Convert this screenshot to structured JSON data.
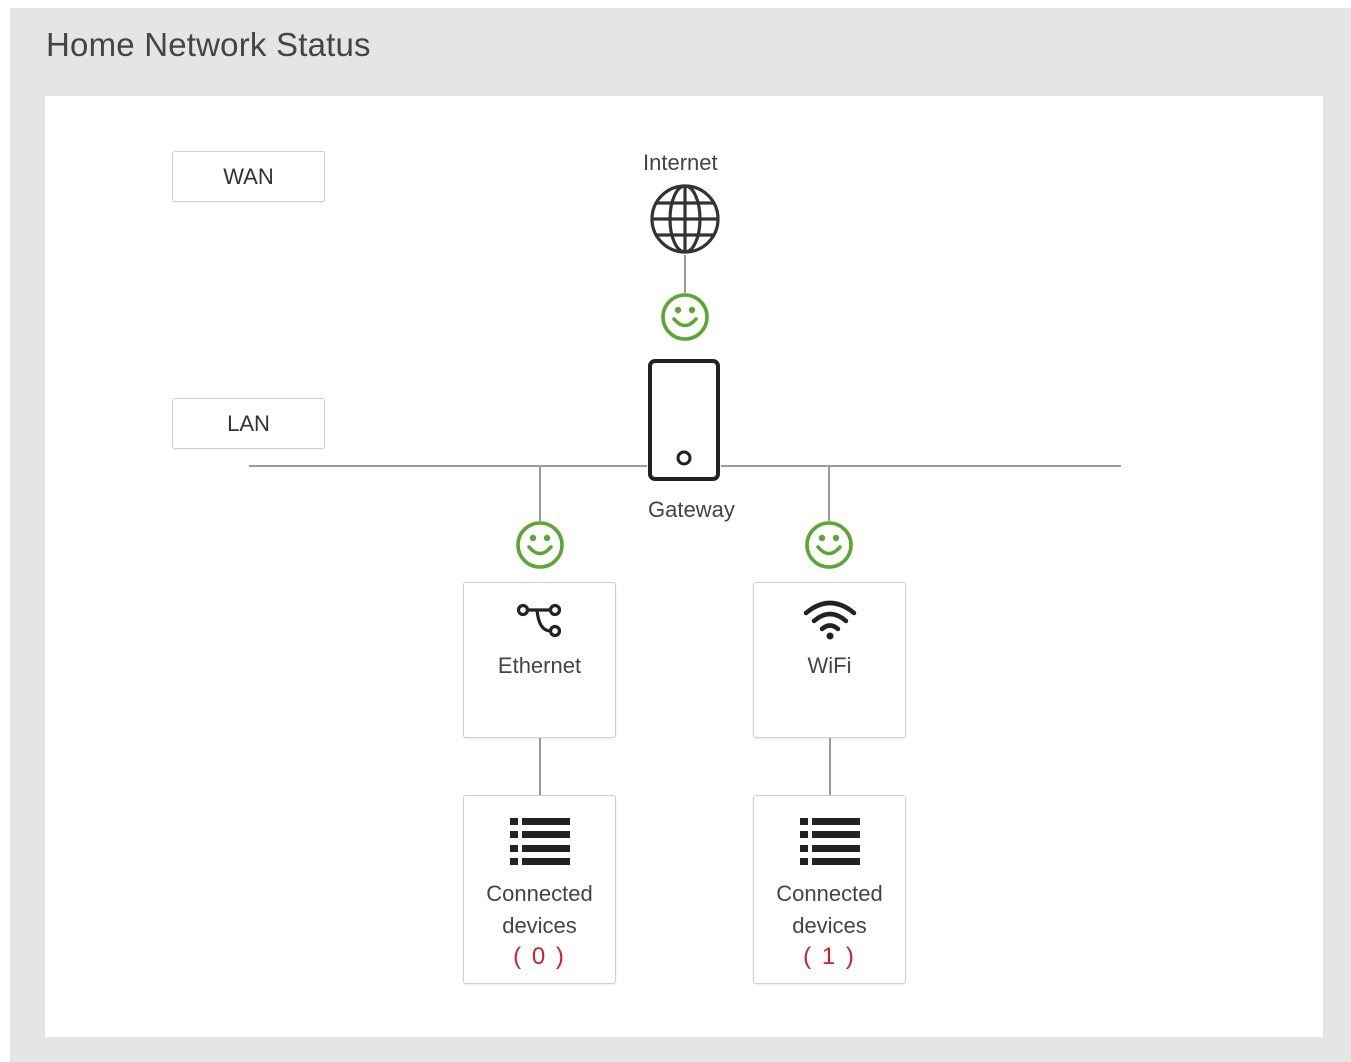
{
  "page_title": "Home Network Status",
  "sections": {
    "wan": "WAN",
    "lan": "LAN"
  },
  "internet": {
    "label": "Internet",
    "status": "connected"
  },
  "gateway": {
    "label": "Gateway"
  },
  "ethernet": {
    "label": "Ethernet",
    "status": "connected",
    "devices_label_line1": "Connected",
    "devices_label_line2": "devices",
    "devices_count_text": "( 0 )"
  },
  "wifi": {
    "label": "WiFi",
    "status": "connected",
    "devices_label_line1": "Connected",
    "devices_label_line2": "devices",
    "devices_count_text": "( 1 )"
  },
  "colors": {
    "status_ok": "#5aa832",
    "count": "#d0202a",
    "background": "#e5e5e5"
  }
}
